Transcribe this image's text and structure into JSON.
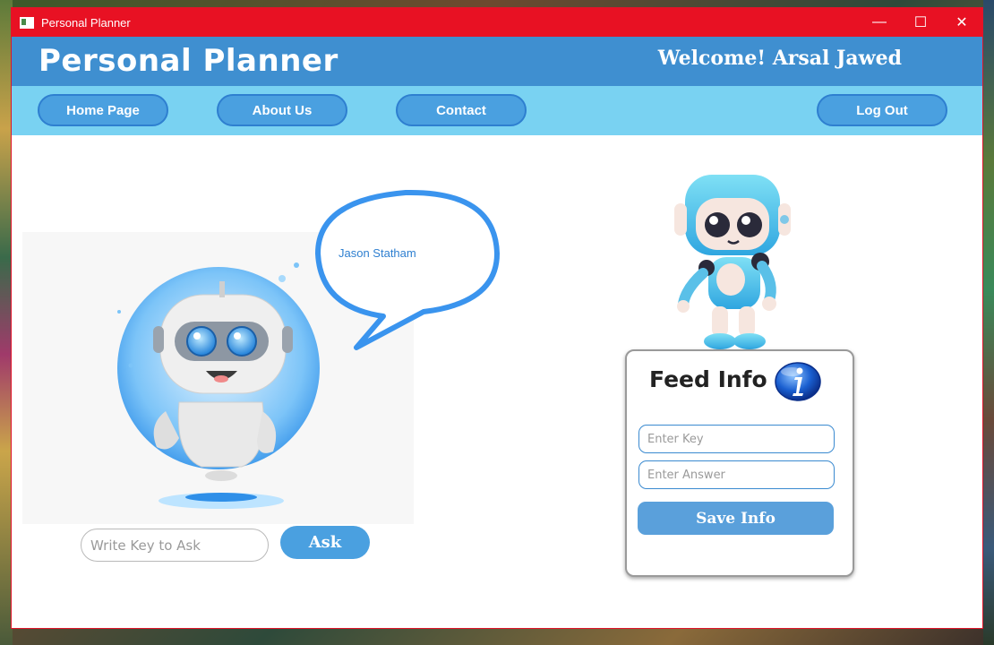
{
  "window": {
    "title": "Personal Planner",
    "controls": {
      "minimize": "—",
      "maximize": "☐",
      "close": "✕"
    }
  },
  "header": {
    "brand": "Personal Planner",
    "welcome": "Welcome! Arsal Jawed"
  },
  "nav": {
    "home": "Home Page",
    "about": "About Us",
    "contact": "Contact",
    "logout": "Log Out"
  },
  "chat": {
    "speech_text": "Jason Statham",
    "input_placeholder": "Write Key to Ask",
    "ask_label": "Ask"
  },
  "feed": {
    "title": "Feed Info",
    "key_placeholder": "Enter Key",
    "answer_placeholder": "Enter Answer",
    "save_label": "Save Info"
  },
  "colors": {
    "titlebar": "#e81123",
    "header": "#3f8fd0",
    "navbar": "#79d2f2",
    "accent": "#4aa0e0"
  }
}
